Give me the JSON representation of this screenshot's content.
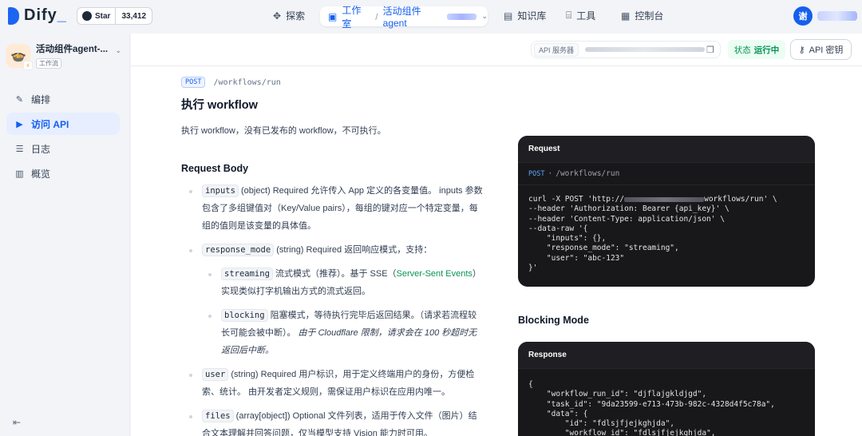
{
  "brand": {
    "logo_text": "Dify",
    "star_label": "Star",
    "star_count": "33,412"
  },
  "nav": {
    "explore": "探索",
    "studio": "工作室",
    "app_name": "活动组件agent",
    "knowledge": "知识库",
    "tools": "工具",
    "console": "控制台"
  },
  "user": {
    "avatar_text": "谢"
  },
  "sidebar": {
    "app_name": "活动组件agent-...",
    "app_type": "工作流",
    "items": [
      {
        "label": "编排",
        "icon": "edit-icon"
      },
      {
        "label": "访问 API",
        "icon": "terminal-icon"
      },
      {
        "label": "日志",
        "icon": "log-icon"
      },
      {
        "label": "概览",
        "icon": "chart-icon"
      }
    ]
  },
  "header": {
    "api_server_tag": "API 服务器",
    "status_label": "状态",
    "status_value": "运行中",
    "api_key_label": "API 密钥"
  },
  "doc": {
    "method": "POST",
    "path": "/workflows/run",
    "title": "执行 workflow",
    "description": "执行 workflow，没有已发布的 workflow，不可执行。",
    "request_body_title": "Request Body",
    "params": {
      "inputs_name": "inputs",
      "inputs_desc": " (object) Required 允许传入 App 定义的各变量值。 inputs 参数包含了多组键值对（Key/Value pairs），每组的键对应一个特定变量，每组的值则是该变量的具体值。",
      "response_mode_name": "response_mode",
      "response_mode_desc": " (string) Required 返回响应模式，支持：",
      "streaming_name": "streaming",
      "streaming_desc_a": " 流式模式（推荐）。基于 SSE（",
      "streaming_link": "Server-Sent Events",
      "streaming_desc_b": "）实现类似打字机输出方式的流式返回。",
      "blocking_name": "blocking",
      "blocking_desc": " 阻塞模式，等待执行完毕后返回结果。（请求若流程较长可能会被中断）。",
      "blocking_note": " 由于 Cloudflare 限制，请求会在 100 秒超时无返回后中断。",
      "user_name": "user",
      "user_desc": " (string) Required 用户标识，用于定义终端用户的身份，方便检索、统计。 由开发者定义规则，需保证用户标识在应用内唯一。",
      "files_name": "files",
      "files_desc": " (array[object]) Optional 文件列表，适用于传入文件（图片）结合文本理解并回答问题，仅当模型支持 Vision 能力时可用。"
    }
  },
  "request_panel": {
    "title": "Request",
    "method": "POST",
    "path": "/workflows/run",
    "code_line1_a": "curl -X POST 'http://",
    "code_line1_b": "workflows/run' \\",
    "code_rest": "--header 'Authorization: Bearer {api_key}' \\\n--header 'Content-Type: application/json' \\\n--data-raw '{\n    \"inputs\": {},\n    \"response_mode\": \"streaming\",\n    \"user\": \"abc-123\"\n}'"
  },
  "blocking_mode_title": "Blocking Mode",
  "response_panel": {
    "title": "Response",
    "code": "{\n    \"workflow_run_id\": \"djflajgkldjgd\",\n    \"task_id\": \"9da23599-e713-473b-982c-4328d4f5c78a\",\n    \"data\": {\n        \"id\": \"fdlsjfjejkghjda\",\n        \"workflow_id\": \"fdlsjfjejkghjda\","
  }
}
